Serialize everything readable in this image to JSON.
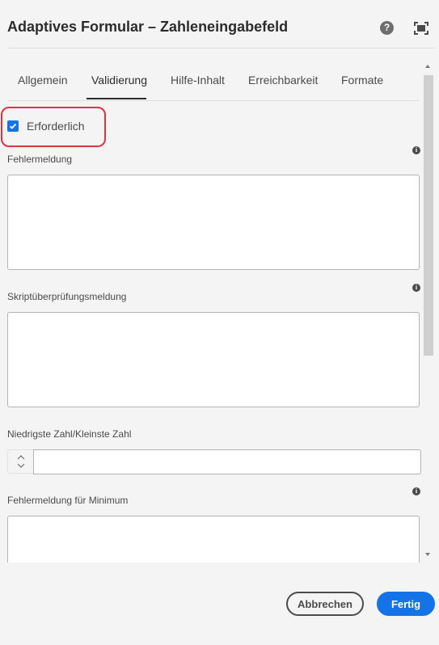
{
  "dialog": {
    "title": "Adaptives Formular – Zahleneingabefeld",
    "help_icon_glyph": "?",
    "icons": [
      "help-icon",
      "fullscreen-icon"
    ]
  },
  "tabs": [
    {
      "label": "Allgemein",
      "active": false
    },
    {
      "label": "Validierung",
      "active": true
    },
    {
      "label": "Hilfe-Inhalt",
      "active": false
    },
    {
      "label": "Erreichbarkeit",
      "active": false
    },
    {
      "label": "Formate",
      "active": false
    }
  ],
  "validation": {
    "required_label": "Erforderlich",
    "required_checked": true,
    "error_message_label": "Fehlermeldung",
    "error_message_value": "",
    "script_message_label": "Skriptüberprüfungsmeldung",
    "script_message_value": "",
    "min_number_label": "Niedrigste Zahl/Kleinste Zahl",
    "min_number_value": "",
    "min_error_label": "Fehlermeldung für Minimum",
    "min_error_value": "",
    "info_glyph": "i"
  },
  "footer": {
    "cancel_label": "Abbrechen",
    "done_label": "Fertig"
  },
  "colors": {
    "accent": "#1473e6",
    "highlight": "#d7373f",
    "background": "#f4f4f4"
  }
}
